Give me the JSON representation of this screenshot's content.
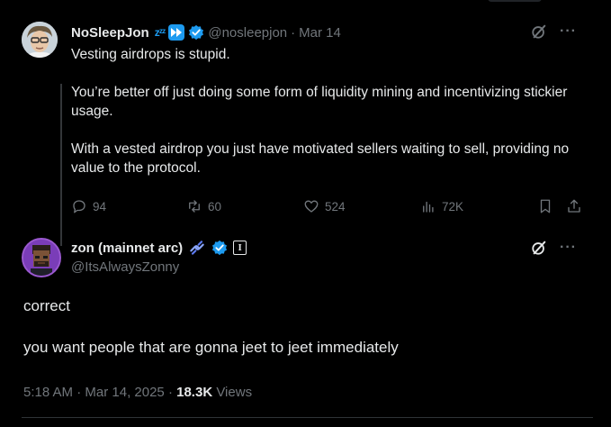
{
  "parent_tweet": {
    "display_name": "NoSleepJon",
    "name_emoji": "zᶻᶻ",
    "handle": "@nosleepjon",
    "separator": "·",
    "date": "Mar 14",
    "text_paragraphs": [
      "Vesting airdrops is stupid.",
      "You’re better off just doing some form of liquidity mining and incentivizing stickier usage.",
      "With a vested airdrop you just have motivated sellers waiting to sell, providing no value to the protocol."
    ],
    "stats": {
      "replies": "94",
      "reposts": "60",
      "likes": "524",
      "views": "72K"
    }
  },
  "reply_tweet": {
    "display_name": "zon (mainnet arc)",
    "affiliate_badge": "I",
    "handle": "@ItsAlwaysZonny",
    "text_paragraphs": [
      "correct",
      "you want people that are gonna jeet to jeet immediately"
    ],
    "time": "5:18 AM",
    "dot": "·",
    "date": "Mar 14, 2025",
    "views_count": "18.3K",
    "views_label": "Views"
  },
  "icons": {
    "more": "more-icon",
    "grok": "grok-icon"
  },
  "colors": {
    "background": "#000000",
    "text": "#e7e9ea",
    "muted": "#71767b",
    "accent": "#1d9bf0",
    "divider": "#2f3336"
  }
}
